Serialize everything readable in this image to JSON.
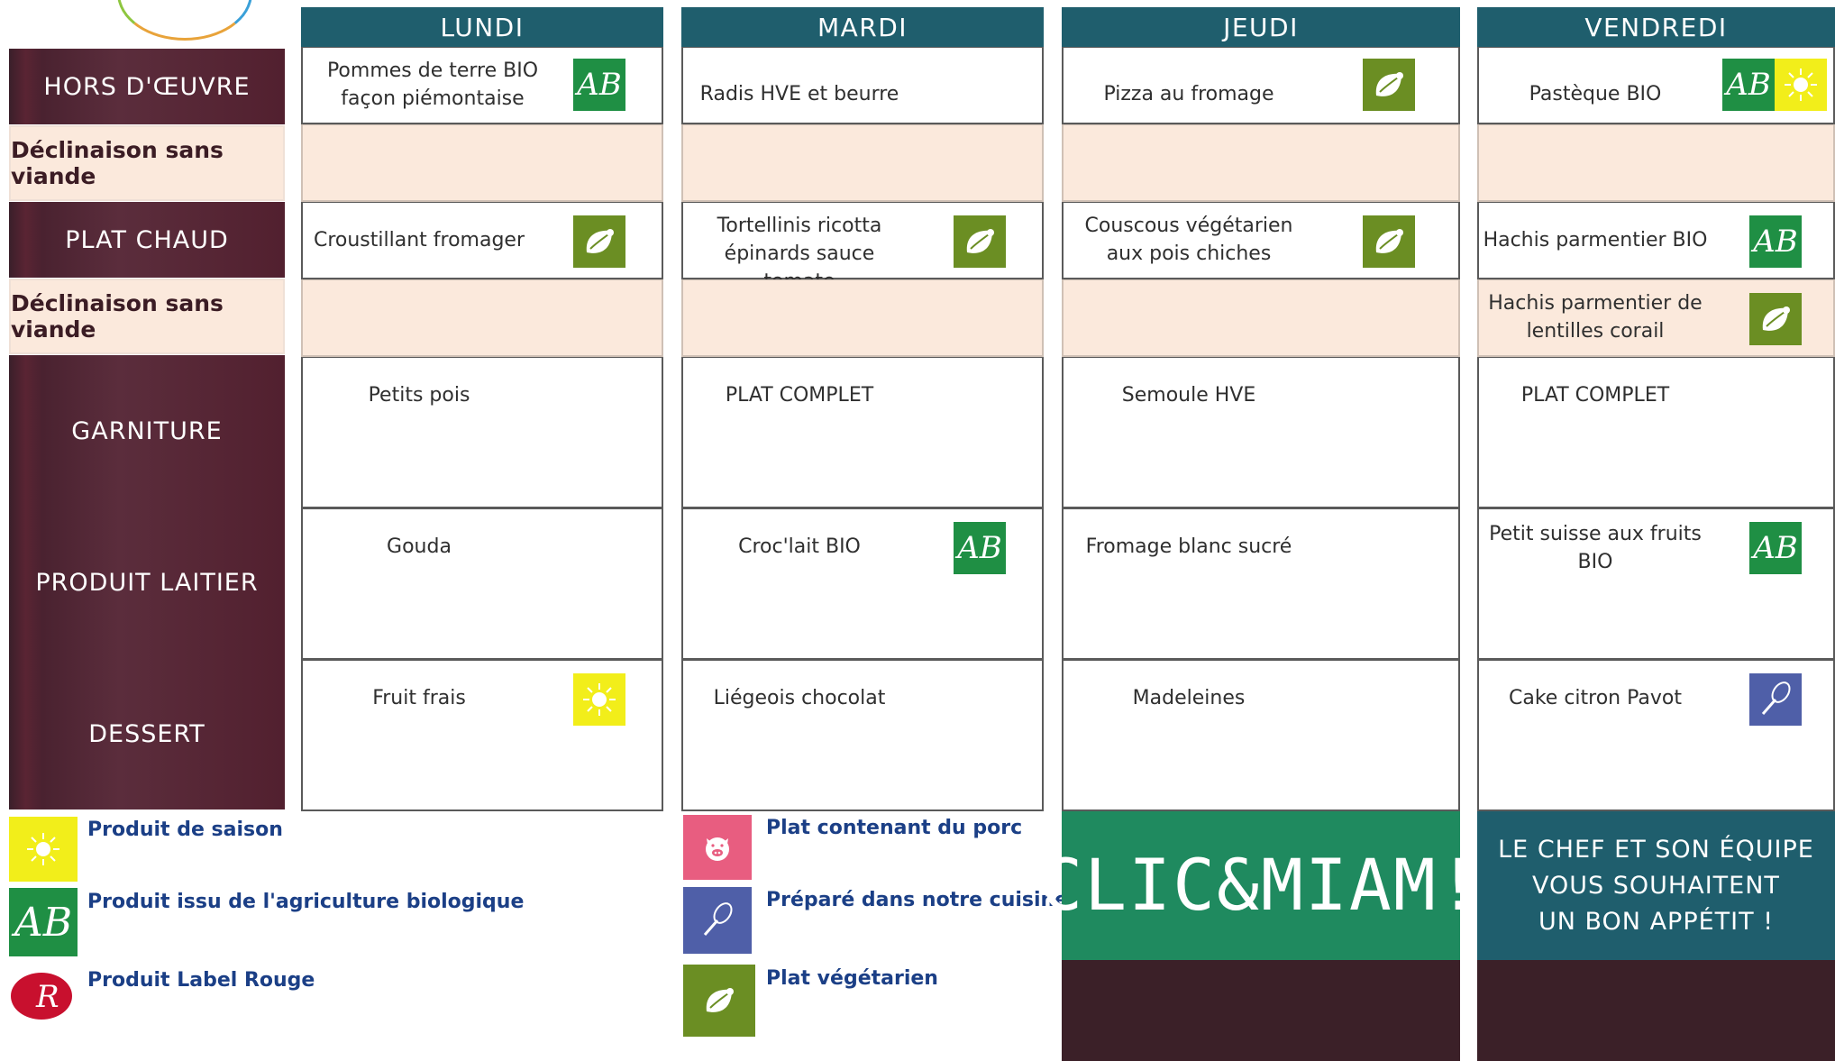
{
  "categories": {
    "hors_doeuvre": "HORS D'ŒUVRE",
    "sans_viande_1": "Déclinaison sans viande",
    "plat_chaud": "PLAT CHAUD",
    "sans_viande_2": "Déclinaison sans viande",
    "garniture": "GARNITURE",
    "produit_laitier": "PRODUIT LAITIER",
    "dessert": "DESSERT"
  },
  "days": {
    "lundi": {
      "name": "LUNDI",
      "hors": "Pommes de terre BIO façon piémontaise",
      "hors_icon": "ab-bio-icon",
      "plat": "Croustillant fromager",
      "plat_icon": "vegetarian-icon",
      "garniture": "Petits pois",
      "laitier": "Gouda",
      "dessert": "Fruit frais",
      "dessert_icon": "seasonal-sun-icon"
    },
    "mardi": {
      "name": "MARDI",
      "hors": "Radis HVE et beurre",
      "plat": "Tortellinis ricotta épinards sauce tomate",
      "plat_icon": "vegetarian-icon",
      "garniture": "PLAT COMPLET",
      "laitier": "Croc'lait BIO",
      "laitier_icon": "ab-bio-icon",
      "dessert": "Liégeois chocolat"
    },
    "jeudi": {
      "name": "JEUDI",
      "hors": "Pizza au fromage",
      "hors_icon": "vegetarian-icon",
      "plat": "Couscous végétarien aux pois chiches",
      "plat_icon": "vegetarian-icon",
      "garniture": "Semoule HVE",
      "laitier": "Fromage blanc sucré",
      "dessert": "Madeleines"
    },
    "vendredi": {
      "name": "VENDREDI",
      "hors": "Pastèque BIO",
      "hors_icons": [
        "ab-bio-icon",
        "seasonal-sun-icon"
      ],
      "plat": "Hachis parmentier BIO",
      "plat_icon": "ab-bio-icon",
      "sans_viande": "Hachis parmentier de lentilles corail",
      "sans_viande_icon": "vegetarian-icon",
      "garniture": "PLAT COMPLET",
      "laitier": "Petit suisse aux fruits BIO",
      "laitier_icon": "ab-bio-icon",
      "dessert": "Cake citron Pavot",
      "dessert_icon": "homemade-whisk-icon"
    }
  },
  "legend": {
    "saison": "Produit de saison",
    "bio": "Produit issu de l'agriculture biologique",
    "label_rouge": "Produit Label Rouge",
    "porc": "Plat contenant du porc",
    "cuisine": "Préparé dans notre cuisine",
    "vegetarien": "Plat végétarien"
  },
  "badges": {
    "ab_text": "AB"
  },
  "footer": {
    "clic_miam": "CLIC&MIAM!",
    "chef_line1": "LE CHEF ET SON ÉQUIPE",
    "chef_line2": "VOUS SOUHAITENT",
    "chef_line3": "UN BON APPÉTIT !"
  },
  "colors": {
    "header_teal": "#1f5e6d",
    "category_maroon": "#52202f",
    "subrow_peach": "#fbe9dc",
    "bio_green": "#1f8f44",
    "veg_olive": "#6b8e23",
    "sun_yellow": "#f2ee1a",
    "whisk_blue": "#4f5fa8",
    "pork_pink": "#e85d80",
    "legend_blue": "#1b3f86",
    "clic_green": "#1f8a5f"
  }
}
